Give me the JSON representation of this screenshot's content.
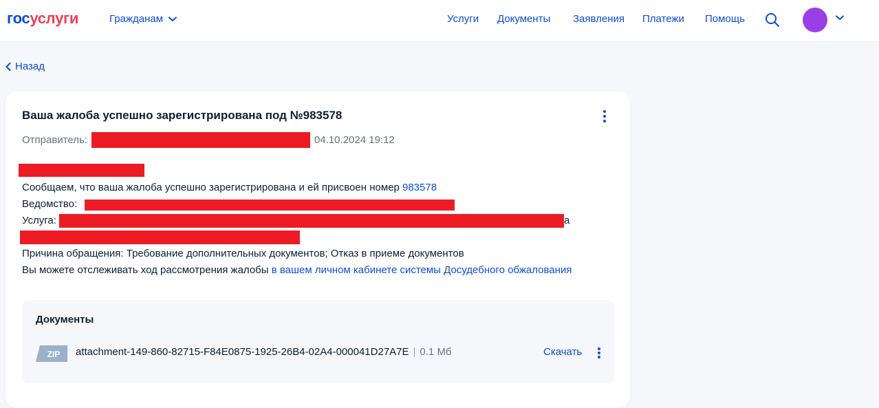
{
  "header": {
    "logo_part1": "гос",
    "logo_part2": "услуги",
    "citizen_menu": "Гражданам",
    "nav": [
      "Услуги",
      "Документы",
      "Заявления",
      "Платежи",
      "Помощь"
    ]
  },
  "back_label": "Назад",
  "card": {
    "title": "Ваша жалоба успешно зарегистрирована под №983578",
    "sender_label": "Отправитель:",
    "datetime": "04.10.2024 19:12",
    "message_prefix": "Сообщаем, что ваша жалоба успешно зарегистрирована и ей присвоен номер",
    "complaint_number": "983578",
    "department_label": "Ведомство:",
    "service_label": "Услуга:",
    "service_tail": "а",
    "reason": "Причина обращения: Требование дополнительных документов; Отказ в приеме документов",
    "track_prefix": "Вы можете отслеживать ход рассмотрения жалобы",
    "track_link": "в вашем личном кабинете системы Досудебного обжалования"
  },
  "documents": {
    "title": "Документы",
    "file_type": "ZIP",
    "file_name": "attachment-149-860-82715-F84E0875-1925-26B4-02A4-000041D27A7E",
    "separator": "|",
    "file_size": "0.1 Мб",
    "download_label": "Скачать"
  },
  "colors": {
    "brand_blue": "#0d4cd3",
    "brand_red": "#ee3f58",
    "redaction": "#ed1c24",
    "avatar": "#9a3ee6"
  }
}
